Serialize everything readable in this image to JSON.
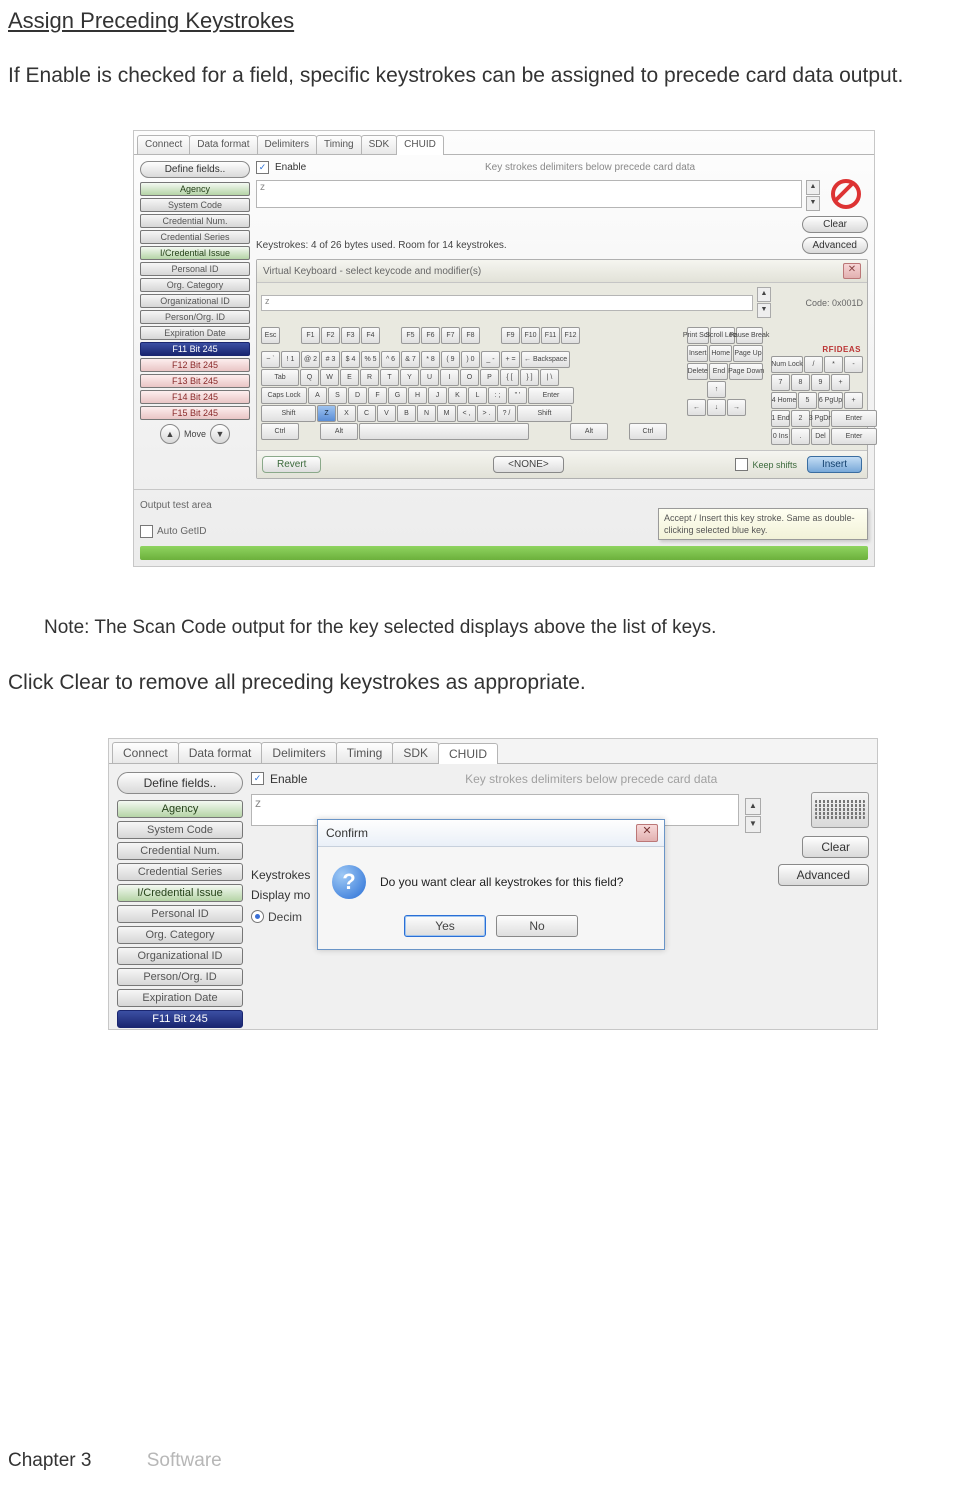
{
  "page": {
    "heading": "Assign Preceding Keystrokes",
    "intro": "If Enable is checked for a field, specific keystrokes can be assigned to precede card data output.",
    "note": "Note:  The Scan Code output for the key selected displays above the list of keys.",
    "clear_text": "Click Clear to remove all preceding keystrokes as appropriate.",
    "footer_chapter": "Chapter 3",
    "footer_section": "Software"
  },
  "screenshot1": {
    "tabs": [
      "Connect",
      "Data format",
      "Delimiters",
      "Timing",
      "SDK",
      "CHUID"
    ],
    "active_tab": "CHUID",
    "define_fields": "Define fields..",
    "enable_label": "Enable",
    "enable_hint": "Key strokes delimiters below precede card data",
    "z_value": "z",
    "clear_btn": "Clear",
    "status": "Keystrokes: 4 of 26 bytes used. Room for 14 keystrokes.",
    "advanced_btn": "Advanced",
    "fields": [
      {
        "label": "Agency",
        "class": "green"
      },
      {
        "label": "System Code",
        "class": "gray"
      },
      {
        "label": "Credential Num.",
        "class": "gray"
      },
      {
        "label": "Credential Series",
        "class": "gray"
      },
      {
        "label": "I/Credential Issue",
        "class": "green"
      },
      {
        "label": "Personal ID",
        "class": "gray"
      },
      {
        "label": "Org. Category",
        "class": "gray"
      },
      {
        "label": "Organizational ID",
        "class": "gray"
      },
      {
        "label": "Person/Org. ID",
        "class": "gray"
      },
      {
        "label": "Expiration Date",
        "class": "gray"
      },
      {
        "label": "F11 Bit 245",
        "class": "sel"
      },
      {
        "label": "F12 Bit 245",
        "class": "red"
      },
      {
        "label": "F13 Bit 245",
        "class": "red"
      },
      {
        "label": "F14 Bit 245",
        "class": "red"
      },
      {
        "label": "F15 Bit 245",
        "class": "red"
      }
    ],
    "move_label": "Move",
    "output_area_label": "Output test area",
    "auto_getid_label": "Auto GetID",
    "vk": {
      "title": "Virtual Keyboard - select keycode and modifier(s)",
      "code_value": "z",
      "code_label": "Code: 0x001D",
      "revert": "Revert",
      "none": "<NONE>",
      "keep_shifts": "Keep shifts",
      "insert": "Insert",
      "tooltip": "Accept / Insert this key stroke. Same as double-clicking selected blue key.",
      "brand": "RFIDEAS",
      "rows_main": [
        [
          "Esc",
          "",
          "F1",
          "F2",
          "F3",
          "F4",
          "",
          "F5",
          "F6",
          "F7",
          "F8",
          "",
          "F9",
          "F10",
          "F11",
          "F12"
        ],
        [
          "~ `",
          "! 1",
          "@ 2",
          "# 3",
          "$ 4",
          "% 5",
          "^ 6",
          "& 7",
          "* 8",
          "( 9",
          ") 0",
          "_ -",
          "+ =",
          "← Backspace"
        ],
        [
          "Tab",
          "Q",
          "W",
          "E",
          "R",
          "T",
          "Y",
          "U",
          "I",
          "O",
          "P",
          "{ [",
          "} ]",
          "| \\"
        ],
        [
          "Caps Lock",
          "A",
          "S",
          "D",
          "F",
          "G",
          "H",
          "J",
          "K",
          "L",
          ": ;",
          "\" '",
          "Enter"
        ],
        [
          "Shift",
          "Z",
          "X",
          "C",
          "V",
          "B",
          "N",
          "M",
          "< ,",
          "> .",
          "? /",
          "Shift"
        ],
        [
          "Ctrl",
          "",
          "Alt",
          "",
          "",
          "Alt",
          "",
          "Ctrl"
        ]
      ],
      "rows_side": [
        [
          "Print Scrn",
          "Scroll Lock",
          "Pause Break"
        ],
        [
          "Insert",
          "Home",
          "Page Up"
        ],
        [
          "Delete",
          "End",
          "Page Down"
        ],
        [
          "",
          "↑",
          ""
        ],
        [
          "←",
          "↓",
          "→"
        ]
      ],
      "rows_num": [
        [
          "Num Lock",
          "/",
          "*",
          "-"
        ],
        [
          "7",
          "8",
          "9",
          "+"
        ],
        [
          "4 Home",
          "5",
          "6 PgUp",
          "+"
        ],
        [
          "1 End",
          "2",
          "3 PgDn",
          "Enter"
        ],
        [
          "0 Ins",
          ".",
          "Del",
          "Enter"
        ]
      ]
    },
    "side_buttons": {
      "clear": "clear",
      "clear2": "Clear"
    }
  },
  "screenshot2": {
    "tabs": [
      "Connect",
      "Data format",
      "Delimiters",
      "Timing",
      "SDK",
      "CHUID"
    ],
    "active_tab": "CHUID",
    "define_fields": "Define fields..",
    "enable_label": "Enable",
    "enable_hint": "Key strokes delimiters below precede card data",
    "z_value": "z",
    "clear_btn": "Clear",
    "advanced_btn": "Advanced",
    "keystrokes_label": "Keystrokes",
    "display_mode_label": "Display mo",
    "decimal_label": "Decim",
    "fields": [
      {
        "label": "Agency",
        "class": "green"
      },
      {
        "label": "System Code",
        "class": "gray"
      },
      {
        "label": "Credential Num.",
        "class": "gray"
      },
      {
        "label": "Credential Series",
        "class": "gray"
      },
      {
        "label": "I/Credential Issue",
        "class": "green"
      },
      {
        "label": "Personal ID",
        "class": "gray"
      },
      {
        "label": "Org. Category",
        "class": "gray"
      },
      {
        "label": "Organizational ID",
        "class": "gray"
      },
      {
        "label": "Person/Org. ID",
        "class": "gray"
      },
      {
        "label": "Expiration Date",
        "class": "gray"
      },
      {
        "label": "F11 Bit 245",
        "class": "sel"
      }
    ],
    "dialog": {
      "title": "Confirm",
      "message": "Do you want clear all keystrokes for this field?",
      "yes": "Yes",
      "no": "No"
    }
  }
}
